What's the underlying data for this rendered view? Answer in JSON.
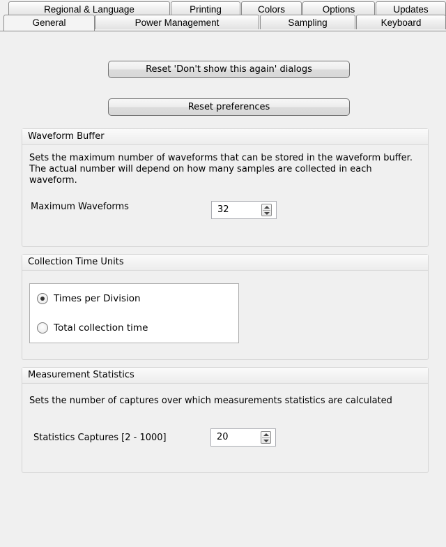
{
  "tabs": {
    "back_row": [
      {
        "label": "Regional & Language"
      },
      {
        "label": "Printing"
      },
      {
        "label": "Colors"
      },
      {
        "label": "Options"
      },
      {
        "label": "Updates"
      }
    ],
    "front_row": [
      {
        "label": "General",
        "active": true
      },
      {
        "label": "Power Management"
      },
      {
        "label": "Sampling"
      },
      {
        "label": "Keyboard"
      }
    ]
  },
  "buttons": {
    "reset_dialogs": "Reset 'Don't show this again' dialogs",
    "reset_preferences": "Reset preferences"
  },
  "waveform_buffer": {
    "title": "Waveform Buffer",
    "description": "Sets the maximum number of waveforms that can be stored in the waveform buffer. The actual number will depend on how many samples are collected in each waveform.",
    "field_label": "Maximum Waveforms",
    "value": "32"
  },
  "collection_time_units": {
    "title": "Collection Time Units",
    "options": [
      {
        "label": "Times per Division",
        "selected": true
      },
      {
        "label": "Total collection time",
        "selected": false
      }
    ]
  },
  "measurement_statistics": {
    "title": "Measurement Statistics",
    "description": "Sets the number of captures over which measurements statistics are calculated",
    "field_label": "Statistics Captures [2 - 1000]",
    "value": "20"
  }
}
